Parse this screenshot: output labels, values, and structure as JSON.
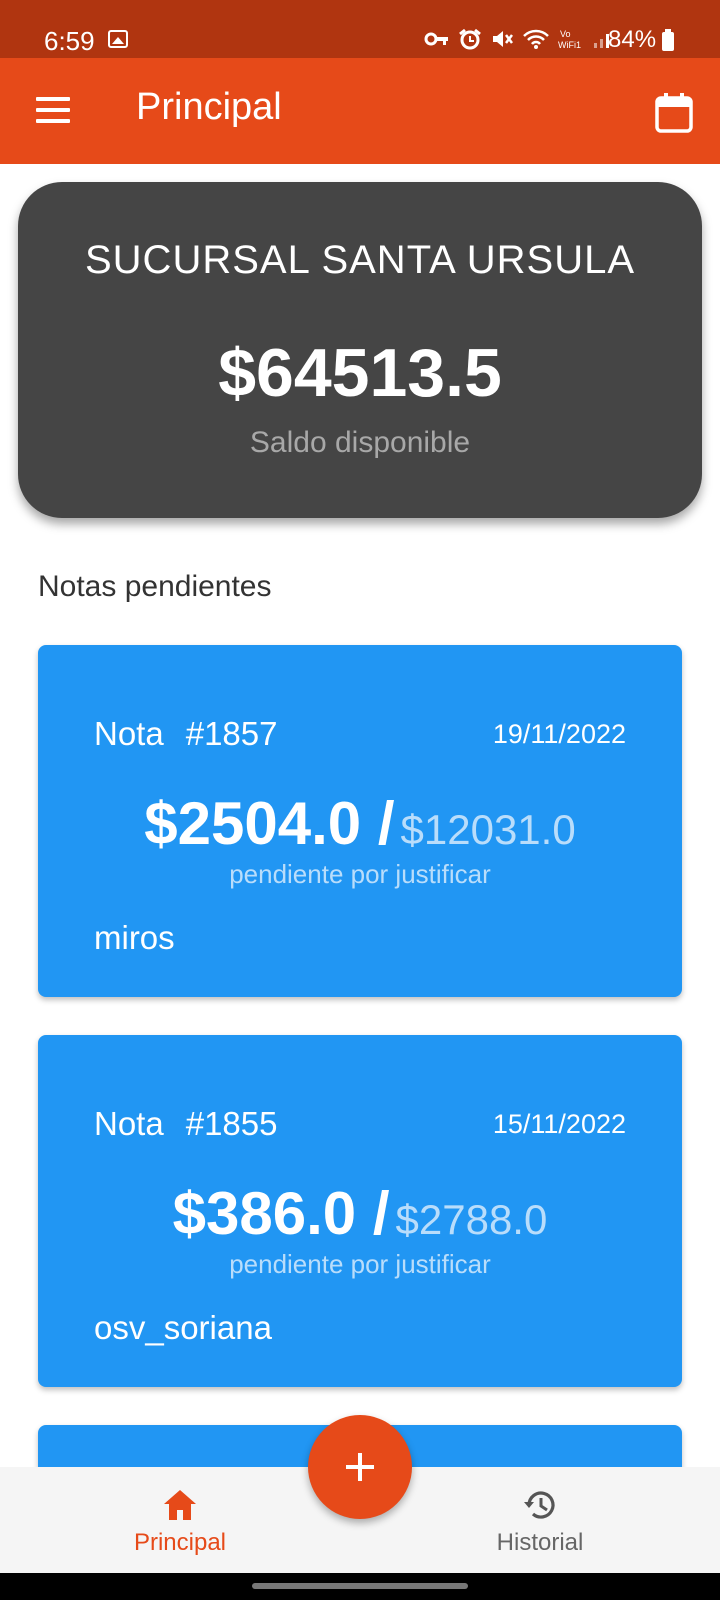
{
  "status_bar": {
    "time": "6:59",
    "battery": "84%",
    "icons": [
      "image-icon",
      "key-icon",
      "alarm-icon",
      "mute-icon",
      "wifi-icon",
      "vowifi-icon",
      "signal-icon",
      "battery-icon"
    ]
  },
  "app_bar": {
    "title": "Principal",
    "background": "#e64a19"
  },
  "balance_card": {
    "branch": "SUCURSAL SANTA URSULA",
    "amount": "$64513.5",
    "label": "Saldo disponible"
  },
  "section_title": "Notas pendientes",
  "notes": [
    {
      "label": "Nota",
      "number": "#1857",
      "date": "19/11/2022",
      "pending": "$2504.0 /",
      "total": "$12031.0",
      "subtitle": "pendiente por justificar",
      "user": "miros"
    },
    {
      "label": "Nota",
      "number": "#1855",
      "date": "15/11/2022",
      "pending": "$386.0 /",
      "total": "$2788.0",
      "subtitle": "pendiente por justificar",
      "user": "osv_soriana"
    }
  ],
  "bottom_nav": {
    "items": [
      {
        "label": "Principal",
        "icon": "home-icon",
        "active": true
      },
      {
        "label": "Historial",
        "icon": "history-icon",
        "active": false
      }
    ]
  },
  "fab": {
    "icon": "plus-icon"
  },
  "colors": {
    "accent": "#e64a19",
    "status_bar": "#b03510",
    "card": "#454545",
    "note": "#2196f3"
  }
}
